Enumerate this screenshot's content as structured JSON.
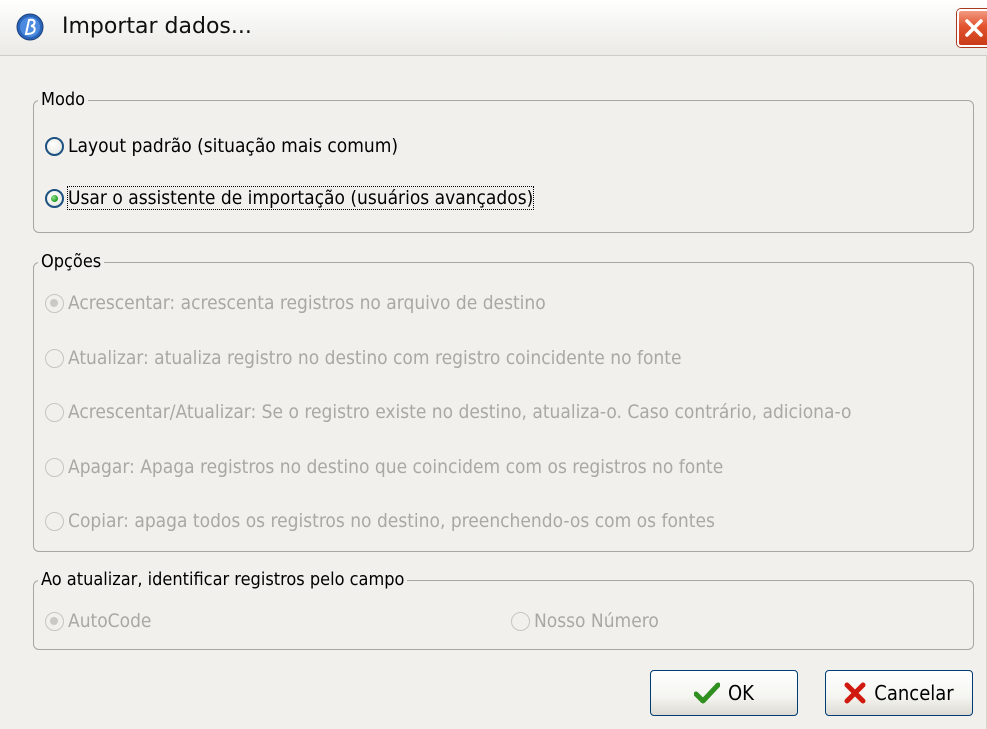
{
  "window": {
    "title": "Importar dados...",
    "app_icon": "app-logo-icon",
    "close_icon": "close-icon"
  },
  "modo": {
    "legend": "Modo",
    "options": [
      {
        "label": "Layout padrão (situação mais comum)",
        "checked": false,
        "enabled": true
      },
      {
        "label": "Usar o assistente de importação (usuários avançados)",
        "checked": true,
        "enabled": true
      }
    ]
  },
  "opcoes": {
    "legend": "Opções",
    "options": [
      {
        "label": "Acrescentar: acrescenta registros no arquivo de destino",
        "checked": true,
        "enabled": false
      },
      {
        "label": "Atualizar: atualiza registro no destino com registro coincidente no fonte",
        "checked": false,
        "enabled": false
      },
      {
        "label": "Acrescentar/Atualizar: Se o registro existe no destino, atualiza-o. Caso contrário, adiciona-o",
        "checked": false,
        "enabled": false
      },
      {
        "label": "Apagar: Apaga registros no destino que coincidem com os registros no fonte",
        "checked": false,
        "enabled": false
      },
      {
        "label": "Copiar: apaga todos os registros no destino, preenchendo-os com os fontes",
        "checked": false,
        "enabled": false
      }
    ]
  },
  "identificar": {
    "legend": "Ao atualizar, identificar registros pelo campo",
    "options": [
      {
        "label": "AutoCode",
        "checked": true,
        "enabled": false
      },
      {
        "label": "Nosso Número",
        "checked": false,
        "enabled": false
      }
    ]
  },
  "buttons": {
    "ok_label": "OK",
    "ok_icon": "checkmark-icon",
    "cancel_label": "Cancelar",
    "cancel_icon": "red-x-icon"
  },
  "colors": {
    "window_bg": "#f1f0ed",
    "disabled_text": "#a9a8a2",
    "radio_border": "#1c5180",
    "radio_dot": "#1f9b1f",
    "close_button": "#e2532e"
  }
}
